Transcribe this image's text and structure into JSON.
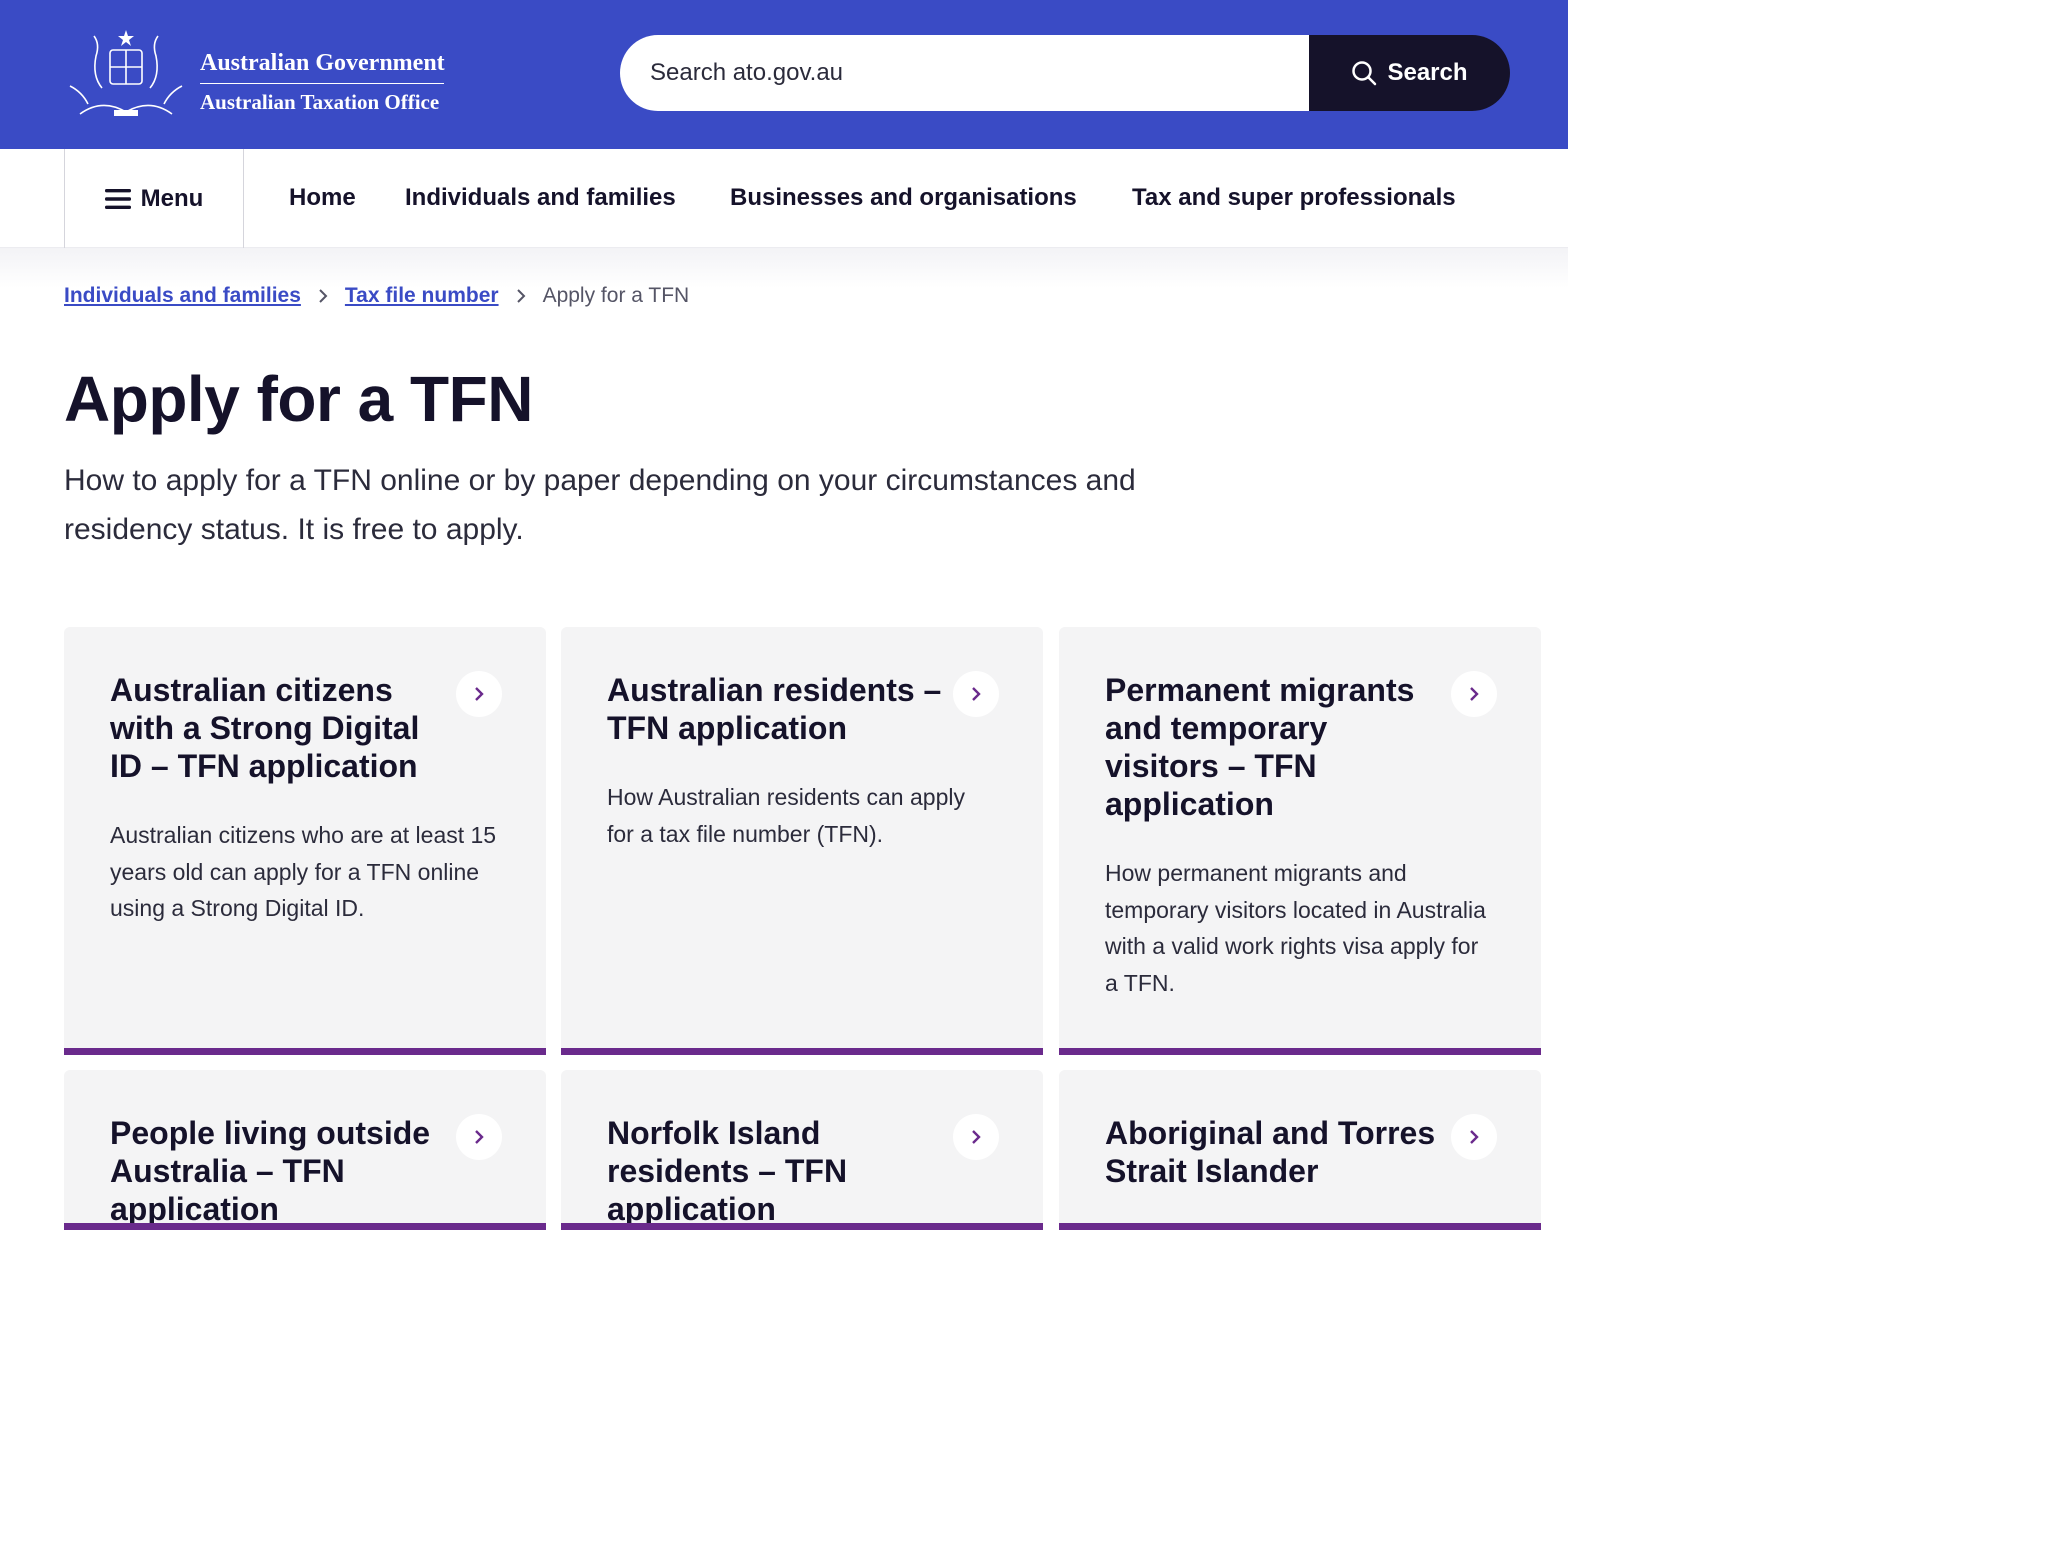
{
  "header": {
    "gov_name": "Australian Government",
    "agency_name": "Australian Taxation Office",
    "search": {
      "placeholder": "Search ato.gov.au",
      "button_label": "Search"
    }
  },
  "nav": {
    "menu_label": "Menu",
    "links": [
      "Home",
      "Individuals and families",
      "Businesses and organisations",
      "Tax and super professionals"
    ]
  },
  "breadcrumb": {
    "items": [
      "Individuals and families",
      "Tax file number"
    ],
    "current": "Apply for a TFN"
  },
  "page": {
    "title": "Apply for a TFN",
    "intro": "How to apply for a TFN online or by paper depending on your circumstances and residency status. It is free to apply."
  },
  "cards": [
    {
      "title": "Australian citizens with a Strong Digital ID – TFN application",
      "desc": "Australian citizens who are at least 15 years old can apply for a TFN online using a Strong Digital ID."
    },
    {
      "title": "Australian residents – TFN application",
      "desc": "How Australian residents can apply for a tax file number (TFN)."
    },
    {
      "title": "Permanent migrants and temporary visitors – TFN application",
      "desc": "How permanent migrants and temporary visitors located in Australia with a valid work rights visa apply for a TFN."
    },
    {
      "title": "People living outside Australia – TFN application",
      "desc": ""
    },
    {
      "title": "Norfolk Island residents – TFN application",
      "desc": ""
    },
    {
      "title": "Aboriginal and Torres Strait Islander",
      "desc": ""
    }
  ],
  "colors": {
    "header_bg": "#3a4bc5",
    "search_button_bg": "#15122a",
    "card_accent": "#6a2a8c",
    "link": "#3a4bc5"
  }
}
